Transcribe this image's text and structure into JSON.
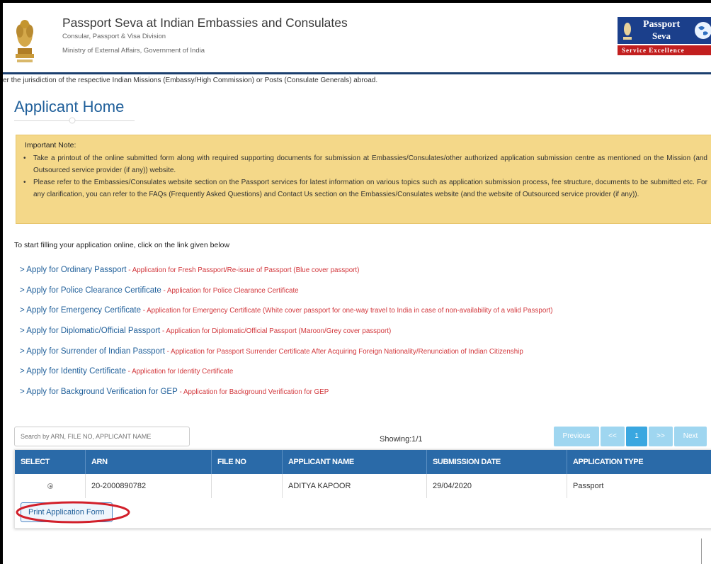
{
  "header": {
    "title": "Passport Seva at Indian Embassies and Consulates",
    "sub1": "Consular, Passport & Visa Division",
    "sub2": "Ministry of External Affairs, Government of India",
    "logo_line1": "Passport",
    "logo_line2": "Seva",
    "logo_tagline": "Service Excellence"
  },
  "marquee": "er the jurisdiction of the respective Indian Missions (Embassy/High Commission) or Posts (Consulate Generals) abroad.",
  "page_title": "Applicant Home",
  "note": {
    "heading": "Important Note:",
    "items": [
      "Take a printout of the online submitted form along with required supporting documents for submission at Embassies/Consulates/other authorized application submission centre as mentioned on the Mission (and Outsourced service provider (if any)) website.",
      "Please refer to the Embassies/Consulates website section on the Passport services for latest information on various topics such as application submission process, fee structure, documents to be submitted etc. For any clarification, you can refer to the FAQs (Frequently Asked Questions) and Contact Us section on the Embassies/Consulates website (and the website of Outsourced service provider (if any))."
    ]
  },
  "start_text": "To start filling your application online, click on the link given below",
  "links": [
    {
      "label": "> Apply for Ordinary Passport",
      "desc": " - Application for Fresh Passport/Re-issue of Passport (Blue cover passport)"
    },
    {
      "label": "> Apply for Police Clearance Certificate",
      "desc": " - Application for Police Clearance Certificate"
    },
    {
      "label": "> Apply for Emergency Certificate",
      "desc": " - Application for Emergency Certificate (White cover passport for one-way travel to India in case of non-availability of a valid Passport)"
    },
    {
      "label": "> Apply for Diplomatic/Official Passport",
      "desc": " - Application for Diplomatic/Official Passport (Maroon/Grey cover passport)"
    },
    {
      "label": "> Apply for Surrender of Indian Passport",
      "desc": " - Application for Passport Surrender Certificate After Acquiring Foreign Nationality/Renunciation of Indian Citizenship"
    },
    {
      "label": "> Apply for Identity Certificate",
      "desc": " - Application for Identity Certificate"
    },
    {
      "label": "> Apply for Background Verification for GEP",
      "desc": " - Application for Background Verification for GEP"
    }
  ],
  "search": {
    "placeholder": "Search by ARN, FILE NO, APPLICANT NAME",
    "value": ""
  },
  "showing": "Showing:1/1",
  "pager": {
    "previous": "Previous",
    "first": "<<",
    "page": "1",
    "last": ">>",
    "next": "Next"
  },
  "table": {
    "columns": [
      "SELECT",
      "ARN",
      "FILE NO",
      "APPLICANT NAME",
      "SUBMISSION DATE",
      "APPLICATION TYPE"
    ],
    "rows": [
      {
        "arn": "20-2000890782",
        "file_no": "",
        "applicant_name": "ADITYA KAPOOR",
        "submission_date": "29/04/2020",
        "application_type": "Passport"
      }
    ]
  },
  "print_button": "Print Application Form",
  "colors": {
    "header_blue": "#1b3f6e",
    "link_blue": "#1f5f9a",
    "desc_red": "#d2373c",
    "note_bg": "#f4d889",
    "table_head": "#2a6aa8",
    "annotation_red": "#d21f2a"
  },
  "icons": {
    "emblem": "national-emblem-icon",
    "globe": "globe-icon"
  }
}
